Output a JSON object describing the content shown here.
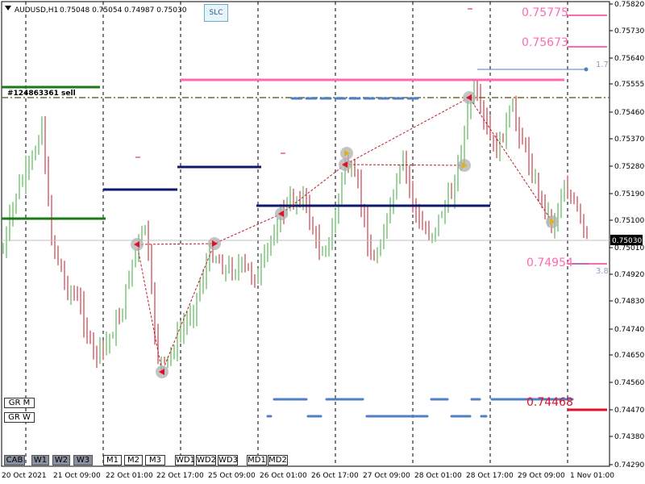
{
  "header": {
    "symbol": "AUDUSD,H1",
    "ohlc": "0.75048 0.75054 0.74987 0.75030"
  },
  "slc_label": "SLC",
  "trade_tag": "#124863361 sell",
  "levels": {
    "l1": "0.75775",
    "l2": "0.75673",
    "l3": "0.74954",
    "l4": "0.74468",
    "fib_top": "1.7",
    "fib_bot": "3.8"
  },
  "price_axis": [
    "0.75820",
    "0.75730",
    "0.75640",
    "0.75555",
    "0.75460",
    "0.75370",
    "0.75280",
    "0.75190",
    "0.75100",
    "0.75010",
    "0.74920",
    "0.74830",
    "0.74740",
    "0.74650",
    "0.74560",
    "0.74470",
    "0.74380",
    "0.74290"
  ],
  "current_price": "0.75030",
  "time_axis": [
    "20 Oct 2021",
    "21 Oct 09:00",
    "22 Oct 01:00",
    "22 Oct 17:00",
    "25 Oct 09:00",
    "26 Oct 01:00",
    "26 Oct 17:00",
    "27 Oct 09:00",
    "28 Oct 01:00",
    "28 Oct 17:00",
    "29 Oct 09:00",
    "1 Nov 01:00"
  ],
  "gr_buttons": {
    "m": "GR M",
    "w": "GR W"
  },
  "bottom_buttons": [
    "CAB",
    "W1",
    "W2",
    "W3",
    "M1",
    "M2",
    "M3",
    "WD1",
    "WD2",
    "WD3",
    "MD1",
    "MD2"
  ],
  "colors": {
    "bull": "#3aa83a",
    "bear": "#c0182a",
    "pink": "#ff69b4",
    "navy": "#0d1a6e",
    "green": "#1a7a1a",
    "blue_dash": "#4f7fc4",
    "red_level": "#e0102a"
  },
  "chart_data": {
    "type": "candlestick",
    "title": "AUDUSD,H1",
    "ylim": [
      0.7427,
      0.7584
    ]
  }
}
